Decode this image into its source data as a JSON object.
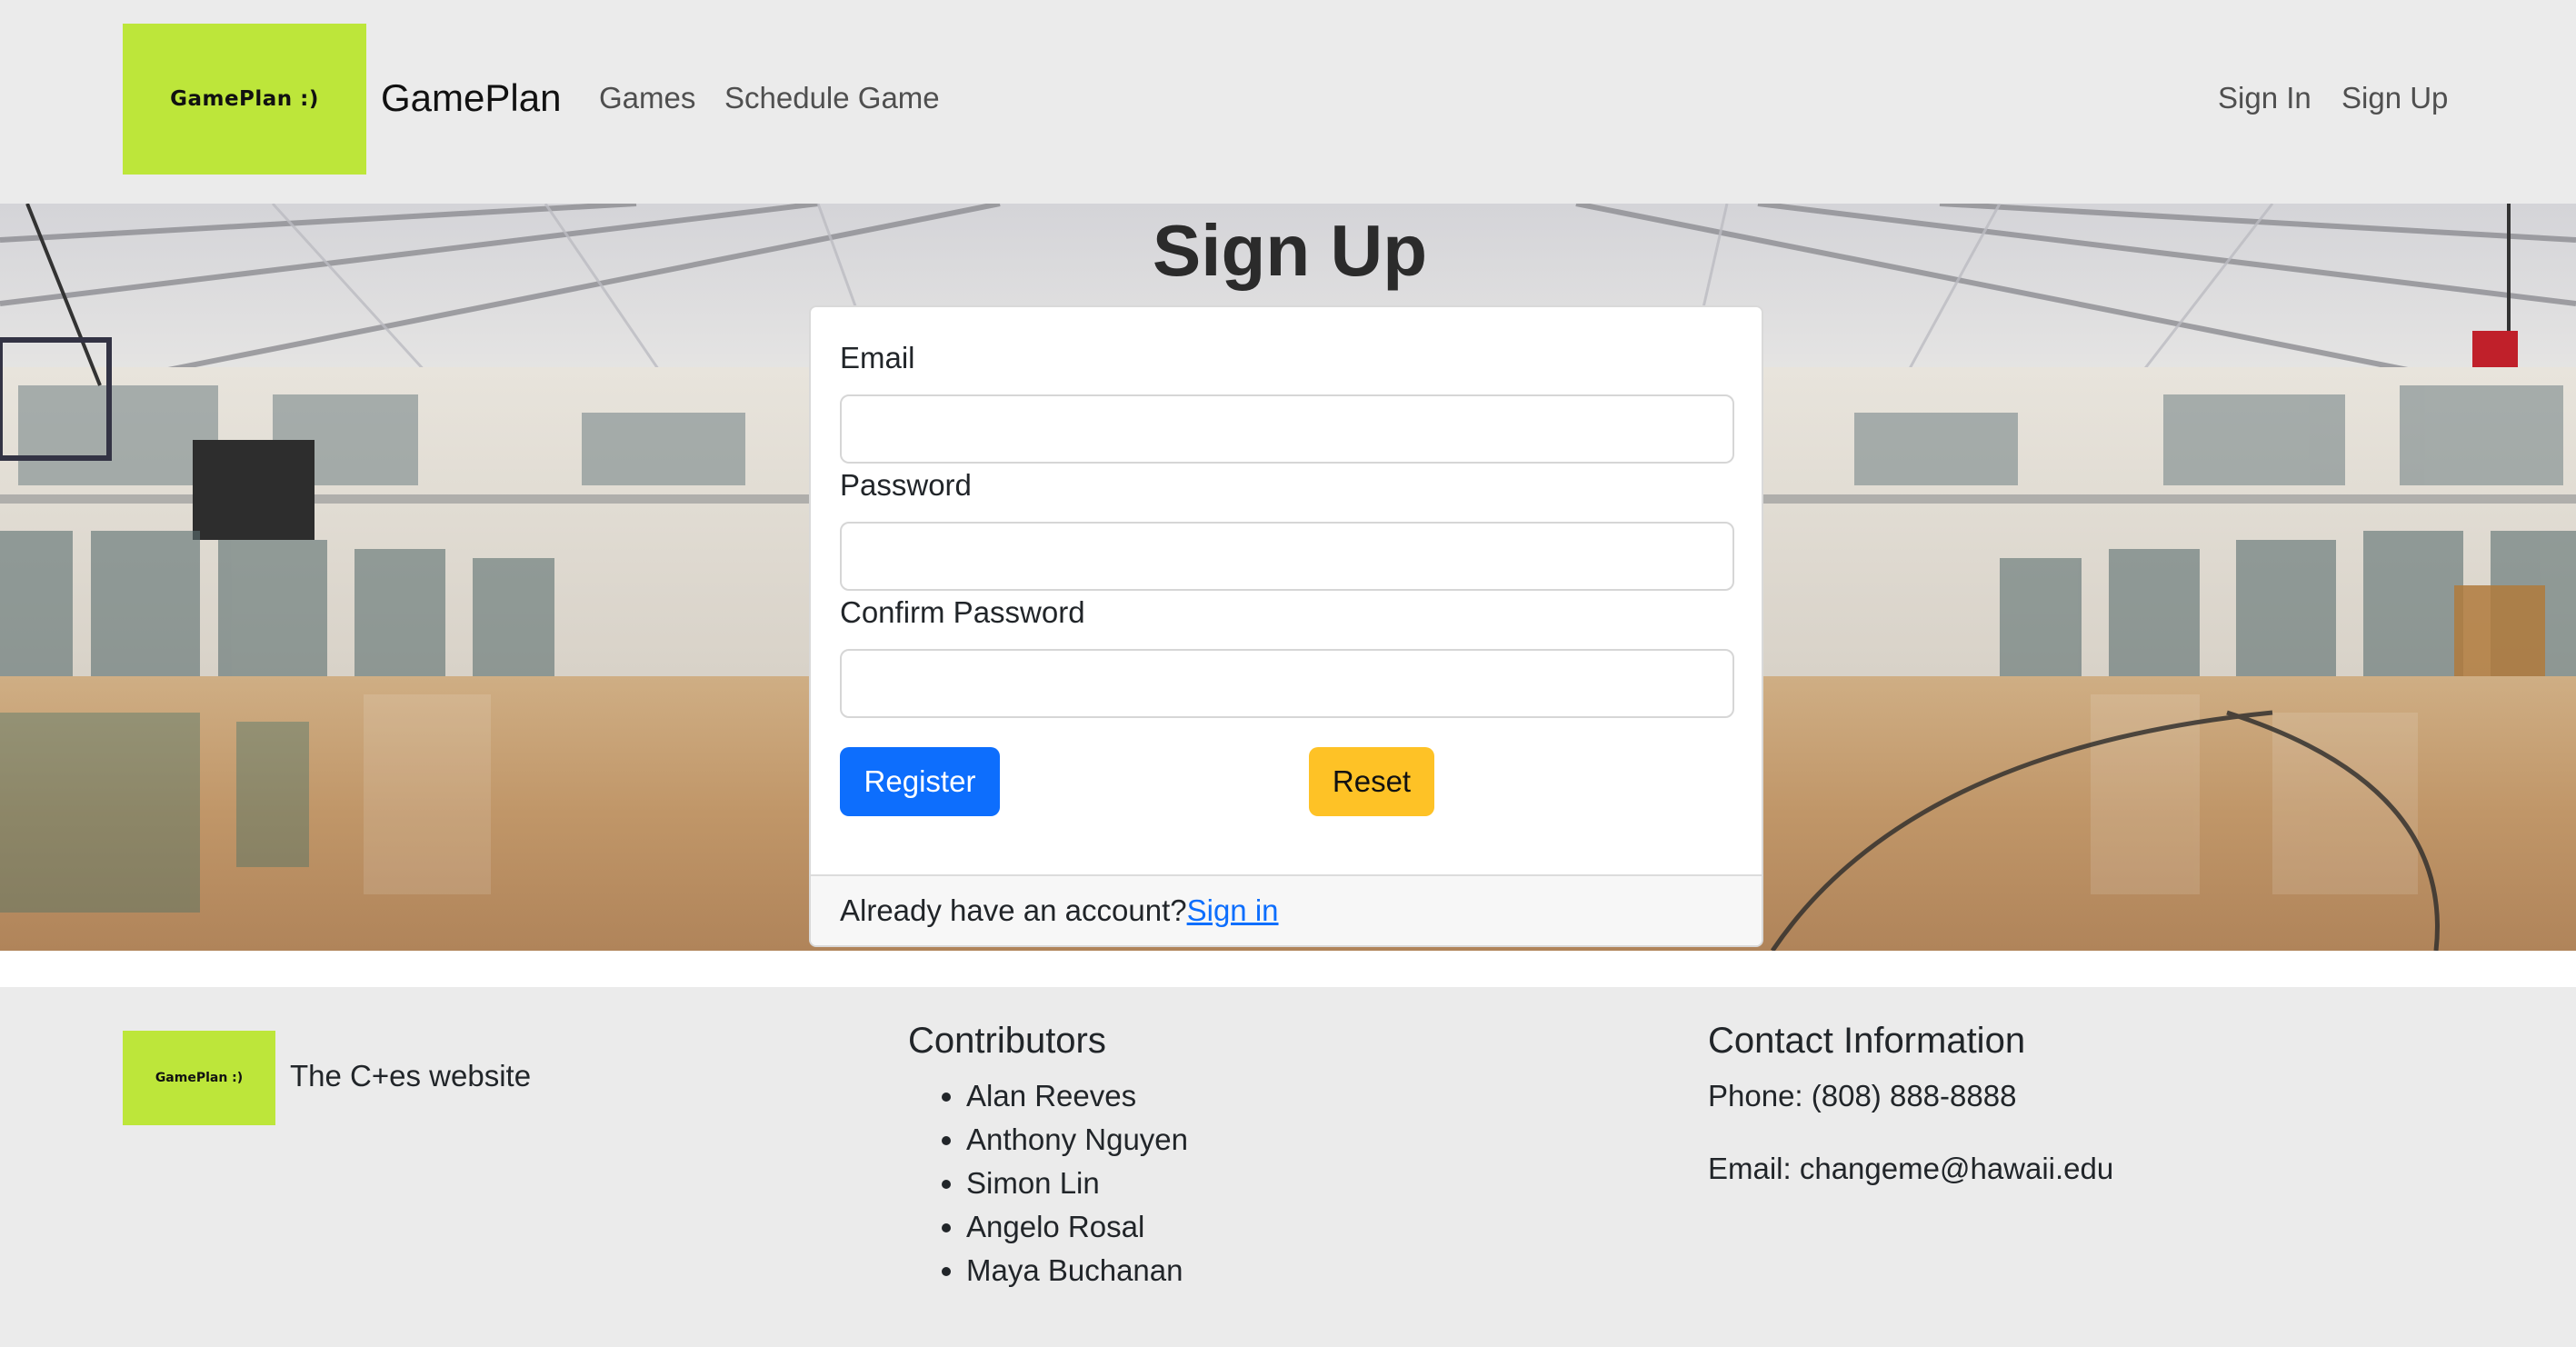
{
  "navbar": {
    "logo_text": "GamePlan :)",
    "brand": "GamePlan",
    "links": [
      "Games",
      "Schedule Game"
    ],
    "right_links": [
      "Sign In",
      "Sign Up"
    ]
  },
  "page": {
    "title": "Sign Up"
  },
  "form": {
    "email_label": "Email",
    "email_value": "",
    "password_label": "Password",
    "password_value": "",
    "confirm_label": "Confirm Password",
    "confirm_value": "",
    "register_label": "Register",
    "reset_label": "Reset",
    "footer_text": "Already have an account?",
    "signin_link": "Sign in"
  },
  "footer": {
    "logo_text": "GamePlan :)",
    "tagline": "The C+es website",
    "contributors_heading": "Contributors",
    "contributors": [
      "Alan Reeves",
      "Anthony Nguyen",
      "Simon Lin",
      "Angelo Rosal",
      "Maya Buchanan"
    ],
    "contact_heading": "Contact Information",
    "phone": "Phone: (808) 888-8888",
    "email": "Email: changeme@hawaii.edu"
  },
  "colors": {
    "logo_bg": "#bde63a",
    "primary": "#0d6efd",
    "warning": "#fec226",
    "bar_bg": "#ebebeb"
  },
  "icons": {
    "hero": "gymnasium-photo"
  }
}
